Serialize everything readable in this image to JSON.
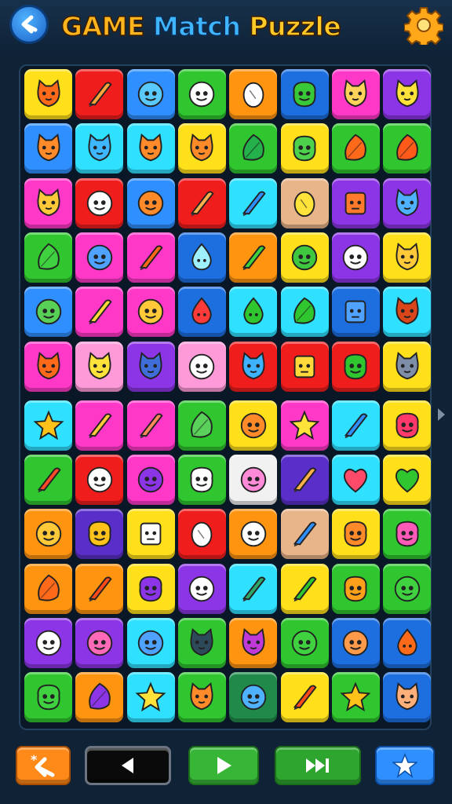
{
  "header": {
    "title_part1": "GAME",
    "title_part2": "Match",
    "title_part3": "Puzzle",
    "back_icon": "back-arrow-icon",
    "settings_icon": "gear-icon"
  },
  "palette": {
    "o": "#ff9410",
    "r": "#f01d1d",
    "b": "#2f8fff",
    "g": "#2fc62f",
    "m": "#ff38c8",
    "p": "#8c35e6",
    "y": "#ffe01a",
    "c": "#2fe0ff",
    "k": "#ff9ad8",
    "t": "#e8b48a",
    "d": "#1d6fe0",
    "l": "#31d97a",
    "w": "#f1f1f1",
    "n": "#1f8a4a",
    "v": "#5a2fc9"
  },
  "board": {
    "columns": 8,
    "rows": [
      [
        {
          "bg": "y",
          "icon": "cat",
          "fg": "#ff6a1a"
        },
        {
          "bg": "r",
          "icon": "pen",
          "fg": "#ffa53a"
        },
        {
          "bg": "b",
          "icon": "face",
          "fg": "#59c9ff"
        },
        {
          "bg": "g",
          "icon": "face",
          "fg": "#ffffff"
        },
        {
          "bg": "o",
          "icon": "egg",
          "fg": "#ffffff"
        },
        {
          "bg": "d",
          "icon": "blob",
          "fg": "#38c838"
        },
        {
          "bg": "m",
          "icon": "cat",
          "fg": "#ffd35a"
        },
        {
          "bg": "p",
          "icon": "cat",
          "fg": "#ffe33a"
        }
      ],
      [
        {
          "bg": "b",
          "icon": "cat",
          "fg": "#ff8a2a"
        },
        {
          "bg": "c",
          "icon": "cat",
          "fg": "#3fb7ff"
        },
        {
          "bg": "c",
          "icon": "cat",
          "fg": "#ff8a2a"
        },
        {
          "bg": "y",
          "icon": "cat",
          "fg": "#ff8a2a"
        },
        {
          "bg": "g",
          "icon": "leaf",
          "fg": "#24b04a"
        },
        {
          "bg": "y",
          "icon": "blob",
          "fg": "#4dd14d"
        },
        {
          "bg": "g",
          "icon": "leaf",
          "fg": "#ff6a1a"
        },
        {
          "bg": "g",
          "icon": "leaf",
          "fg": "#ff5a1a"
        }
      ],
      [
        {
          "bg": "m",
          "icon": "cat",
          "fg": "#ffc93a"
        },
        {
          "bg": "r",
          "icon": "face",
          "fg": "#ffffff"
        },
        {
          "bg": "b",
          "icon": "face",
          "fg": "#ff8a2a"
        },
        {
          "bg": "r",
          "icon": "pen",
          "fg": "#ffb04a"
        },
        {
          "bg": "c",
          "icon": "pen",
          "fg": "#2f8fff"
        },
        {
          "bg": "t",
          "icon": "egg",
          "fg": "#ffe33a"
        },
        {
          "bg": "p",
          "icon": "box",
          "fg": "#ff7a2a"
        },
        {
          "bg": "p",
          "icon": "cat",
          "fg": "#4fb2ff"
        }
      ],
      [
        {
          "bg": "g",
          "icon": "leaf",
          "fg": "#3fd13f"
        },
        {
          "bg": "m",
          "icon": "face",
          "fg": "#4fa2ff"
        },
        {
          "bg": "m",
          "icon": "pen",
          "fg": "#ff6a1a"
        },
        {
          "bg": "d",
          "icon": "drop",
          "fg": "#9ff0ff"
        },
        {
          "bg": "o",
          "icon": "pen",
          "fg": "#3fd13f"
        },
        {
          "bg": "y",
          "icon": "face",
          "fg": "#3fc83f"
        },
        {
          "bg": "p",
          "icon": "face",
          "fg": "#ffffff"
        },
        {
          "bg": "y",
          "icon": "cat",
          "fg": "#ffc93a"
        }
      ],
      [
        {
          "bg": "b",
          "icon": "face",
          "fg": "#58d058"
        },
        {
          "bg": "m",
          "icon": "pen",
          "fg": "#ffd93a"
        },
        {
          "bg": "m",
          "icon": "face",
          "fg": "#ffc93a"
        },
        {
          "bg": "d",
          "icon": "drop",
          "fg": "#ff3a3a"
        },
        {
          "bg": "c",
          "icon": "drop",
          "fg": "#2fc62f"
        },
        {
          "bg": "c",
          "icon": "leaf",
          "fg": "#2fc62f"
        },
        {
          "bg": "d",
          "icon": "box",
          "fg": "#4fa2ff"
        },
        {
          "bg": "c",
          "icon": "cat",
          "fg": "#d8461a"
        }
      ],
      [
        {
          "bg": "m",
          "icon": "cat",
          "fg": "#ff6a1a"
        },
        {
          "bg": "k",
          "icon": "cat",
          "fg": "#ffe33a"
        },
        {
          "bg": "p",
          "icon": "cat",
          "fg": "#3f6ed9"
        },
        {
          "bg": "k",
          "icon": "face",
          "fg": "#ffffff"
        },
        {
          "bg": "r",
          "icon": "cat",
          "fg": "#3fb2ff"
        },
        {
          "bg": "r",
          "icon": "box",
          "fg": "#ffd93a"
        },
        {
          "bg": "r",
          "icon": "blob",
          "fg": "#2fc62f"
        },
        {
          "bg": "y",
          "icon": "cat",
          "fg": "#7e8ea8"
        }
      ],
      [
        {
          "bg": "c",
          "icon": "star",
          "fg": "#ffc21a"
        },
        {
          "bg": "m",
          "icon": "pen",
          "fg": "#ffc93a"
        },
        {
          "bg": "m",
          "icon": "pen",
          "fg": "#ff8a5a"
        },
        {
          "bg": "g",
          "icon": "leaf",
          "fg": "#5ad15a"
        },
        {
          "bg": "y",
          "icon": "face",
          "fg": "#ff8a2a"
        },
        {
          "bg": "m",
          "icon": "star",
          "fg": "#ffe33a"
        },
        {
          "bg": "c",
          "icon": "pen",
          "fg": "#2f8fff"
        },
        {
          "bg": "y",
          "icon": "blob",
          "fg": "#ff3a6a"
        }
      ],
      [
        {
          "bg": "g",
          "icon": "pen",
          "fg": "#ff4a2a"
        },
        {
          "bg": "r",
          "icon": "face",
          "fg": "#ffffff"
        },
        {
          "bg": "m",
          "icon": "face",
          "fg": "#8c35e6"
        },
        {
          "bg": "g",
          "icon": "blob",
          "fg": "#ffffff"
        },
        {
          "bg": "w",
          "icon": "face",
          "fg": "#ff8ad8"
        },
        {
          "bg": "v",
          "icon": "pen",
          "fg": "#ffb04a"
        },
        {
          "bg": "c",
          "icon": "heart",
          "fg": "#ff4a6a"
        },
        {
          "bg": "y",
          "icon": "heart",
          "fg": "#2fc62f"
        }
      ],
      [
        {
          "bg": "o",
          "icon": "face",
          "fg": "#ffc93a"
        },
        {
          "bg": "v",
          "icon": "blob",
          "fg": "#ffc21a"
        },
        {
          "bg": "y",
          "icon": "box",
          "fg": "#ffffff"
        },
        {
          "bg": "r",
          "icon": "egg",
          "fg": "#ffffff"
        },
        {
          "bg": "o",
          "icon": "face",
          "fg": "#ffffff"
        },
        {
          "bg": "t",
          "icon": "pen",
          "fg": "#2f8fff"
        },
        {
          "bg": "y",
          "icon": "blob",
          "fg": "#ff8a2a"
        },
        {
          "bg": "g",
          "icon": "blob",
          "fg": "#ff5ab8"
        }
      ],
      [
        {
          "bg": "o",
          "icon": "leaf",
          "fg": "#ff6a1a"
        },
        {
          "bg": "o",
          "icon": "pen",
          "fg": "#ff4a1a"
        },
        {
          "bg": "y",
          "icon": "blob",
          "fg": "#8c35e6"
        },
        {
          "bg": "p",
          "icon": "face",
          "fg": "#ffffff"
        },
        {
          "bg": "c",
          "icon": "pen",
          "fg": "#2fa86a"
        },
        {
          "bg": "y",
          "icon": "pen",
          "fg": "#2fc62f"
        },
        {
          "bg": "g",
          "icon": "blob",
          "fg": "#ffa01a"
        },
        {
          "bg": "g",
          "icon": "face",
          "fg": "#3fd13f"
        }
      ],
      [
        {
          "bg": "p",
          "icon": "face",
          "fg": "#ffffff"
        },
        {
          "bg": "p",
          "icon": "face",
          "fg": "#ff6ab8"
        },
        {
          "bg": "c",
          "icon": "face",
          "fg": "#4fa2ff"
        },
        {
          "bg": "g",
          "icon": "cat",
          "fg": "#2d4a5a"
        },
        {
          "bg": "o",
          "icon": "cat",
          "fg": "#c03ad8"
        },
        {
          "bg": "g",
          "icon": "face",
          "fg": "#3fd13f"
        },
        {
          "bg": "d",
          "icon": "face",
          "fg": "#ff9a4a"
        },
        {
          "bg": "d",
          "icon": "drop",
          "fg": "#ff6a1a"
        }
      ],
      [
        {
          "bg": "g",
          "icon": "blob",
          "fg": "#3fd13f"
        },
        {
          "bg": "o",
          "icon": "leaf",
          "fg": "#8c35e6"
        },
        {
          "bg": "c",
          "icon": "star",
          "fg": "#ffe33a"
        },
        {
          "bg": "g",
          "icon": "cat",
          "fg": "#ff8a2a"
        },
        {
          "bg": "n",
          "icon": "face",
          "fg": "#4fb2ff"
        },
        {
          "bg": "y",
          "icon": "pen",
          "fg": "#ff4a1a"
        },
        {
          "bg": "g",
          "icon": "star",
          "fg": "#ffc21a"
        },
        {
          "bg": "d",
          "icon": "cat",
          "fg": "#ffb07a"
        }
      ]
    ]
  },
  "bottom_bar": {
    "buttons": [
      {
        "name": "shuffle-button",
        "icon": "shuffle-back-icon",
        "color": "#ff8a1a"
      },
      {
        "name": "previous-button",
        "icon": "previous-icon",
        "color": "#0a0a0a"
      },
      {
        "name": "play-button",
        "icon": "play-icon",
        "color": "#36b536"
      },
      {
        "name": "skip-forward-button",
        "icon": "skip-forward-icon",
        "color": "#2ea52e"
      },
      {
        "name": "favorite-button",
        "icon": "star-icon",
        "color": "#2f8fff"
      }
    ]
  }
}
